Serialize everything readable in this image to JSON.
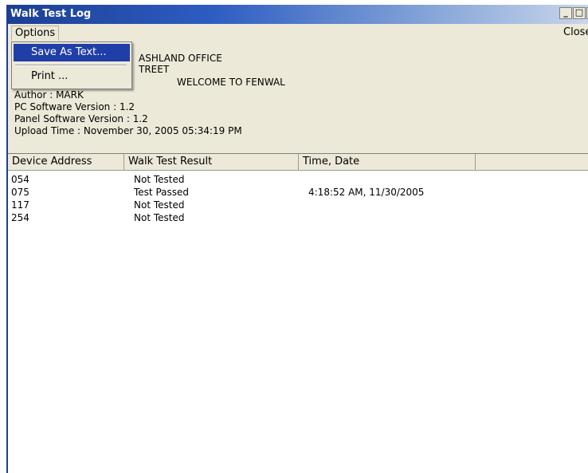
{
  "window": {
    "title": "Walk Test Log",
    "controls": {
      "minimize": "_",
      "maximize": "□",
      "close": "×"
    }
  },
  "menubar": {
    "options_label": "Options",
    "close_label": "Close"
  },
  "dropdown": {
    "items": [
      "Save As Text...",
      "Print ..."
    ],
    "selected": "Save As Text..."
  },
  "info": {
    "office_line": "ASHLAND OFFICE",
    "street_line": "TREET",
    "welcome_line": "WELCOME TO FENWAL",
    "author": "Author : MARK",
    "pc_software": "PC Software Version : 1.2",
    "panel_software": "Panel Software Version : 1.2",
    "upload_time": "Upload Time : November 30, 2005 05:34:19 PM"
  },
  "table": {
    "columns": [
      "Device Address",
      "Walk Test Result",
      "Time, Date",
      ""
    ],
    "rows": [
      {
        "address": "054",
        "result": "Not Tested",
        "time": ""
      },
      {
        "address": "075",
        "result": "Test Passed",
        "time": "4:18:52 AM, 11/30/2005"
      },
      {
        "address": "117",
        "result": "Not Tested",
        "time": ""
      },
      {
        "address": "254",
        "result": "Not Tested",
        "time": ""
      }
    ]
  },
  "colors": {
    "titlebar": "#1c3f94",
    "menu_highlight": "#1f3ea8",
    "window_bg": "#ece9d8",
    "list_bg": "#ffffff"
  }
}
